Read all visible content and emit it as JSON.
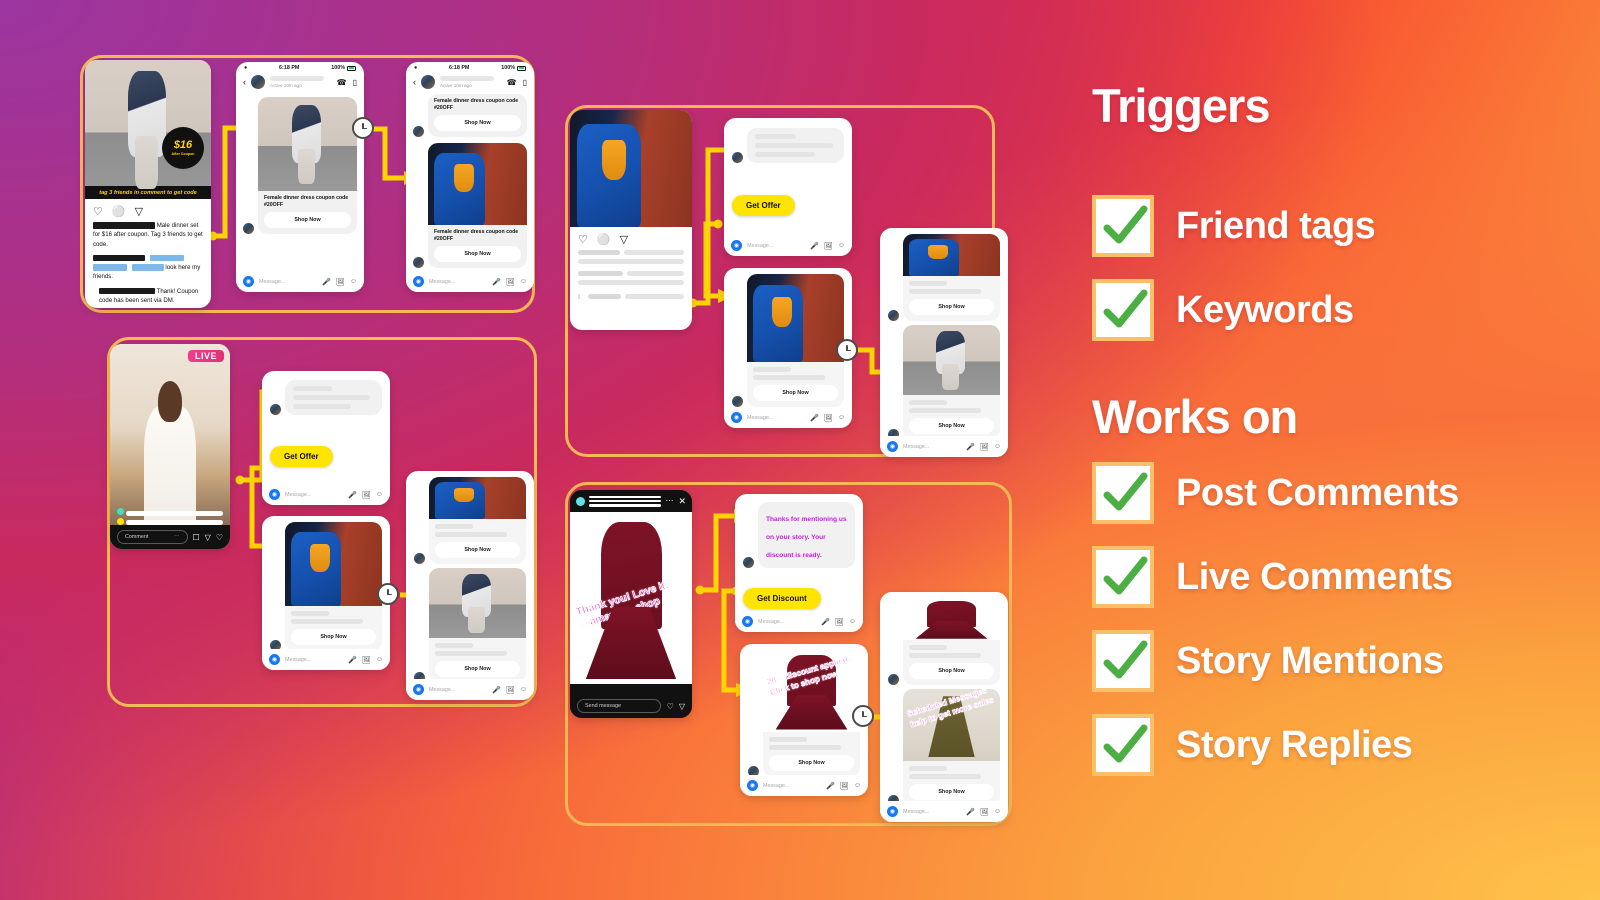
{
  "rail": {
    "triggers_title": "Triggers",
    "triggers": [
      {
        "label": "Friend tags",
        "icon": "check-icon"
      },
      {
        "label": "Keywords",
        "icon": "check-icon"
      }
    ],
    "works_on_title": "Works on",
    "works_on": [
      {
        "label": "Post Comments",
        "icon": "check-icon"
      },
      {
        "label": "Live Comments",
        "icon": "check-icon"
      },
      {
        "label": "Story Mentions",
        "icon": "check-icon"
      },
      {
        "label": "Story Replies",
        "icon": "check-icon"
      }
    ],
    "colors": {
      "check_green": "#4caf43",
      "box_border": "#f9c069",
      "text": "#ffffff"
    }
  },
  "common": {
    "message_placeholder": "Message...",
    "shop_now": "Shop Now",
    "status_time": "6:18 PM",
    "status_battery": "100%",
    "active_status": "Active 10m ago",
    "clock_icon": "clock-icon",
    "mic_icon": "microphone-icon",
    "gallery_icon": "gallery-icon",
    "sticker_icon": "sticker-icon",
    "camera_icon": "camera-icon",
    "phone_icon": "phone-icon",
    "video_icon": "video-camera-icon",
    "back_icon": "back-chevron-icon",
    "heart_icon": "heart-icon",
    "comment_icon": "comment-icon",
    "share_icon": "share-icon"
  },
  "panel_friend_tags": {
    "post": {
      "coupon_price": "$16",
      "coupon_sub": "After Coupon",
      "overlay_caption": "tag 3 friends in comment to get code",
      "caption_line": "Male dinner set for $16 after coupon. Tag 3 friends to get code.",
      "comment_line": "look here my friends.",
      "reply_line": "Thank! Coupon code has been sent via DM."
    },
    "dm1": {
      "bubble_caption": "Female dinner dress coupon code #20OFF"
    },
    "dm2": {
      "bubble1_caption": "Female dinner dress coupon code #20OFF",
      "bubble2_caption": "Female dinner dress coupon code #20OFF"
    }
  },
  "panel_live_comments": {
    "live_badge": "LIVE",
    "comment_placeholder": "Comment",
    "get_offer_label": "Get Offer"
  },
  "panel_post_comments": {
    "get_offer_label": "Get Offer"
  },
  "panel_story_mentions": {
    "story_sticker_line1": "Thank you! Love it.",
    "story_sticker_line2": "@amazing_shop",
    "send_message_placeholder": "Send message",
    "reply_text": "Thanks for mentioning us on your story. Your discount is ready.",
    "get_discount_label": "Get Discount",
    "discount_sticker": "20% discount applied. Click to shop now.",
    "scheduled_sticker": "Scheduled Messages help to get more sales"
  },
  "theme": {
    "panel_border": "#f7b955",
    "wire": "#ffd400",
    "yellow_button": "#ffe400",
    "live_badge_gradient": "#f03d8e"
  }
}
